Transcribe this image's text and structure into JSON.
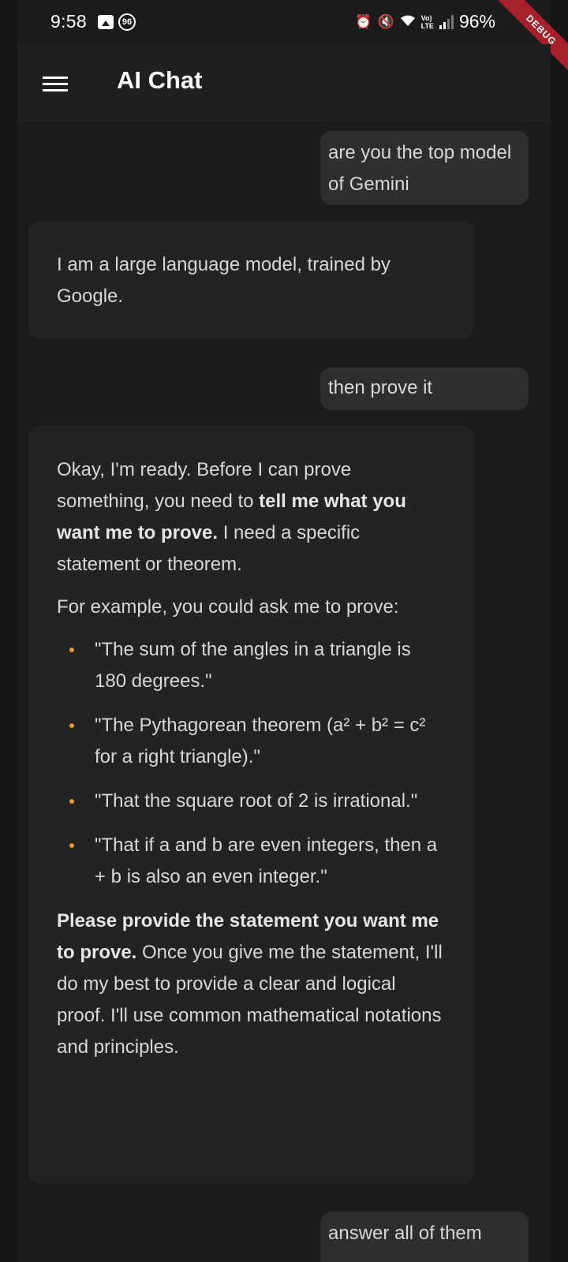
{
  "status_bar": {
    "time": "9:58",
    "notification_badge": "96",
    "battery": "96%",
    "lte_top": "Vo)",
    "lte_bottom": "LTE",
    "debug_label": "DEBUG"
  },
  "appbar": {
    "title": "AI Chat"
  },
  "messages": [
    {
      "role": "user",
      "text": "are you the top model of Gemini"
    },
    {
      "role": "assistant",
      "text": "I am a large language model, trained by Google."
    },
    {
      "role": "user",
      "text": "then prove it"
    },
    {
      "role": "assistant",
      "p1_a": "Okay, I'm ready.  Before I can prove something, you need to ",
      "p1_bold": "tell me what you want me to prove.",
      "p1_b": "  I need a specific statement or theorem.",
      "p2": "For example, you could ask me to prove:",
      "items": [
        "\"The sum of the angles in a triangle is 180 degrees.\"",
        "\"The Pythagorean theorem (a² + b² = c² for a right triangle).\"",
        "\"That the square root of 2 is irrational.\"",
        "\"That if a and b are even integers, then a + b is also an even integer.\""
      ],
      "p3_bold": "Please provide the statement you want me to prove.",
      "p3": "  Once you give me the statement, I'll do my best to provide a clear and logical proof. I'll use common mathematical notations and principles."
    },
    {
      "role": "user",
      "text": "answer all of them"
    }
  ],
  "colors": {
    "background": "#1b1b1b",
    "appbar": "#1f1f1f",
    "user_bubble": "#2e2e2e",
    "assistant_bubble": "#232323",
    "bullet": "#e49a3a",
    "debug_ribbon": "#a5202a"
  }
}
